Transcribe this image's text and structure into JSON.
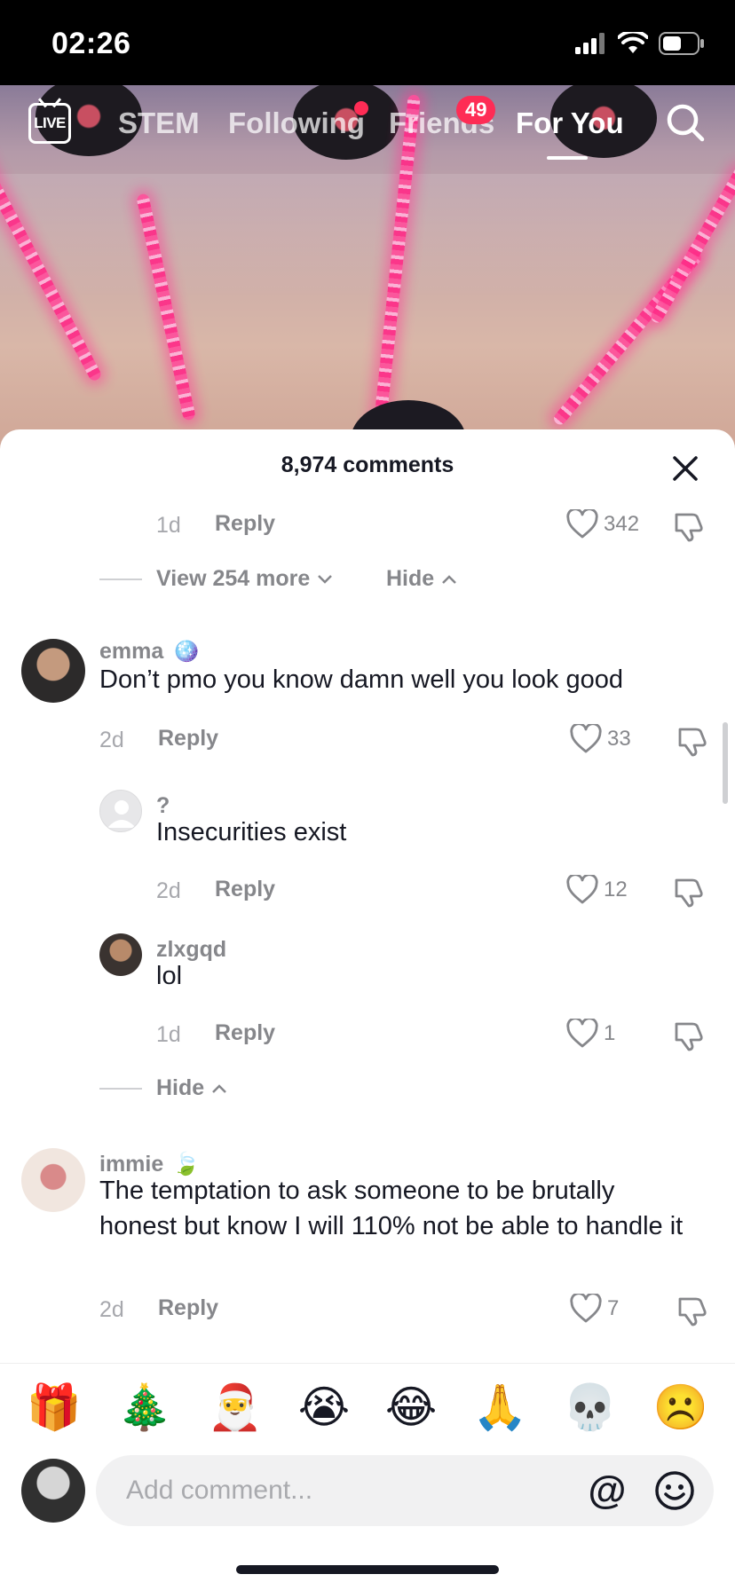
{
  "status_bar": {
    "time": "02:26"
  },
  "nav": {
    "live_label": "LIVE",
    "tabs": [
      {
        "label": "STEM"
      },
      {
        "label": "Following"
      },
      {
        "label": "Friends",
        "badge": "49"
      },
      {
        "label": "For You",
        "active": true
      }
    ]
  },
  "comments_sheet": {
    "title": "8,974 comments",
    "reply_label": "Reply",
    "top_row": {
      "date": "1d",
      "likes": "342"
    },
    "view_more": {
      "label": "View 254 more",
      "hide_label": "Hide"
    },
    "comments": [
      {
        "user": "emma",
        "badge_emoji": "🪩",
        "text": "Don’t pmo you know damn well you look good",
        "date": "2d",
        "likes": "33",
        "replies": [
          {
            "user": "?",
            "text": "Insecurities exist",
            "date": "2d",
            "likes": "12"
          },
          {
            "user": "zlxgqd",
            "text": "lol",
            "date": "1d",
            "likes": "1"
          }
        ],
        "hide_label": "Hide"
      },
      {
        "user": "immie",
        "badge_emoji": "🍃",
        "text": "The temptation to ask someone to be brutally honest but know I will 110% not be able to handle it",
        "date": "2d",
        "likes": "7"
      }
    ]
  },
  "emoji_bar": [
    "🎁",
    "🎄",
    "🎅",
    "😭",
    "😂",
    "🙏",
    "💀",
    "☹️"
  ],
  "composer": {
    "placeholder": "Add comment..."
  },
  "colors": {
    "accent": "#fe2c55",
    "muted_text": "#86878b",
    "text": "#161823"
  }
}
